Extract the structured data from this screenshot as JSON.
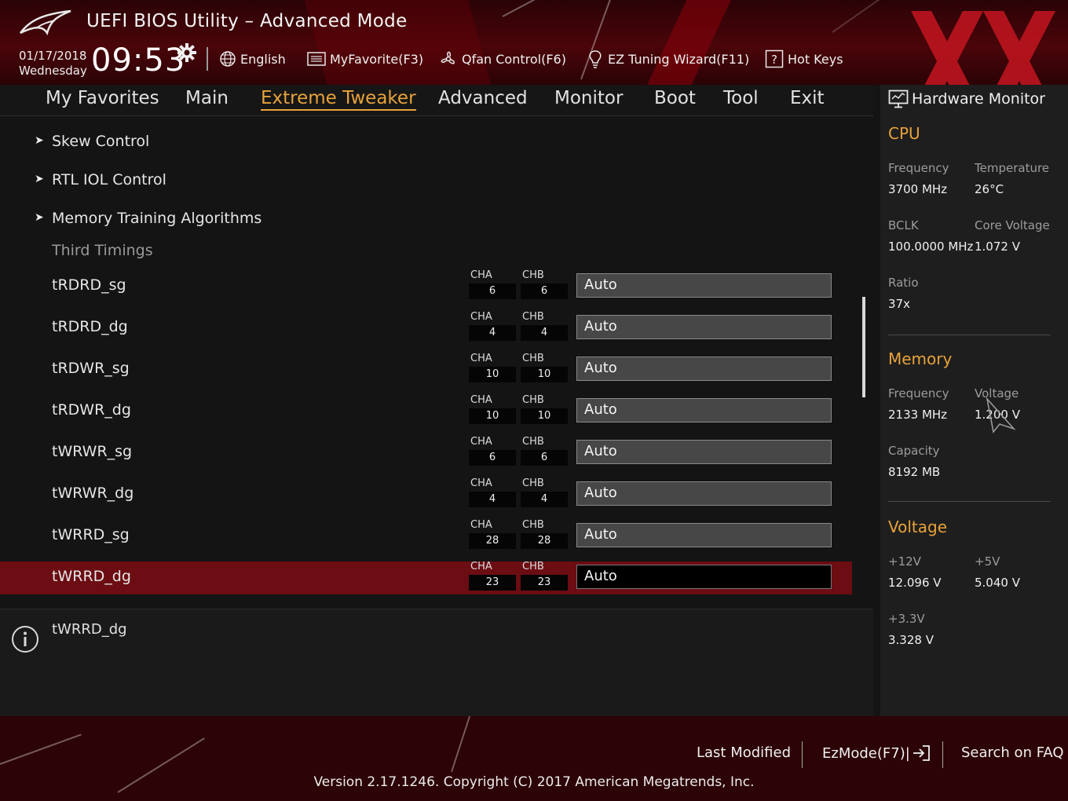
{
  "header": {
    "title": "UEFI BIOS Utility – Advanced Mode",
    "date": "01/17/2018",
    "weekday": "Wednesday",
    "time": "09:53",
    "tools": [
      {
        "label": "English",
        "icon": "globe-icon"
      },
      {
        "label": "MyFavorite(F3)",
        "icon": "favorite-list-icon"
      },
      {
        "label": "Qfan Control(F6)",
        "icon": "fan-icon"
      },
      {
        "label": "EZ Tuning Wizard(F11)",
        "icon": "lightbulb-icon"
      },
      {
        "label": "Hot Keys",
        "icon": "question-box-icon"
      }
    ]
  },
  "tabs": [
    "My Favorites",
    "Main",
    "Extreme Tweaker",
    "Advanced",
    "Monitor",
    "Boot",
    "Tool",
    "Exit"
  ],
  "active_tab": "Extreme Tweaker",
  "menu": {
    "submenus": [
      "Skew Control",
      "RTL IOL Control",
      "Memory Training Algorithms"
    ],
    "section_label": "Third Timings",
    "channel_a_label": "CHA",
    "channel_b_label": "CHB",
    "timings": [
      {
        "name": "tRDRD_sg",
        "cha": "6",
        "chb": "6",
        "value": "Auto"
      },
      {
        "name": "tRDRD_dg",
        "cha": "4",
        "chb": "4",
        "value": "Auto"
      },
      {
        "name": "tRDWR_sg",
        "cha": "10",
        "chb": "10",
        "value": "Auto"
      },
      {
        "name": "tRDWR_dg",
        "cha": "10",
        "chb": "10",
        "value": "Auto"
      },
      {
        "name": "tWRWR_sg",
        "cha": "6",
        "chb": "6",
        "value": "Auto"
      },
      {
        "name": "tWRWR_dg",
        "cha": "4",
        "chb": "4",
        "value": "Auto"
      },
      {
        "name": "tWRRD_sg",
        "cha": "28",
        "chb": "28",
        "value": "Auto"
      },
      {
        "name": "tWRRD_dg",
        "cha": "23",
        "chb": "23",
        "value": "Auto"
      }
    ],
    "selected_timing": "tWRRD_dg"
  },
  "info": {
    "text": "tWRRD_dg"
  },
  "hardware_monitor": {
    "title": "Hardware Monitor",
    "cpu": {
      "heading": "CPU",
      "frequency_label": "Frequency",
      "frequency": "3700 MHz",
      "temperature_label": "Temperature",
      "temperature": "26°C",
      "bclk_label": "BCLK",
      "bclk": "100.0000 MHz",
      "core_voltage_label": "Core Voltage",
      "core_voltage": "1.072 V",
      "ratio_label": "Ratio",
      "ratio": "37x"
    },
    "memory": {
      "heading": "Memory",
      "frequency_label": "Frequency",
      "frequency": "2133 MHz",
      "voltage_label": "Voltage",
      "voltage": "1.200 V",
      "capacity_label": "Capacity",
      "capacity": "8192 MB"
    },
    "voltage": {
      "heading": "Voltage",
      "v12_label": "+12V",
      "v12": "12.096 V",
      "v5_label": "+5V",
      "v5": "5.040 V",
      "v33_label": "+3.3V",
      "v33": "3.328 V"
    }
  },
  "footer": {
    "last_modified": "Last Modified",
    "ezmode": "EzMode(F7)|",
    "search": "Search on FAQ",
    "version": "Version 2.17.1246. Copyright (C) 2017 American Megatrends, Inc."
  },
  "colors": {
    "accent": "#e8a23a",
    "selection": "#6b0d13",
    "brand_red": "#c0151f"
  }
}
